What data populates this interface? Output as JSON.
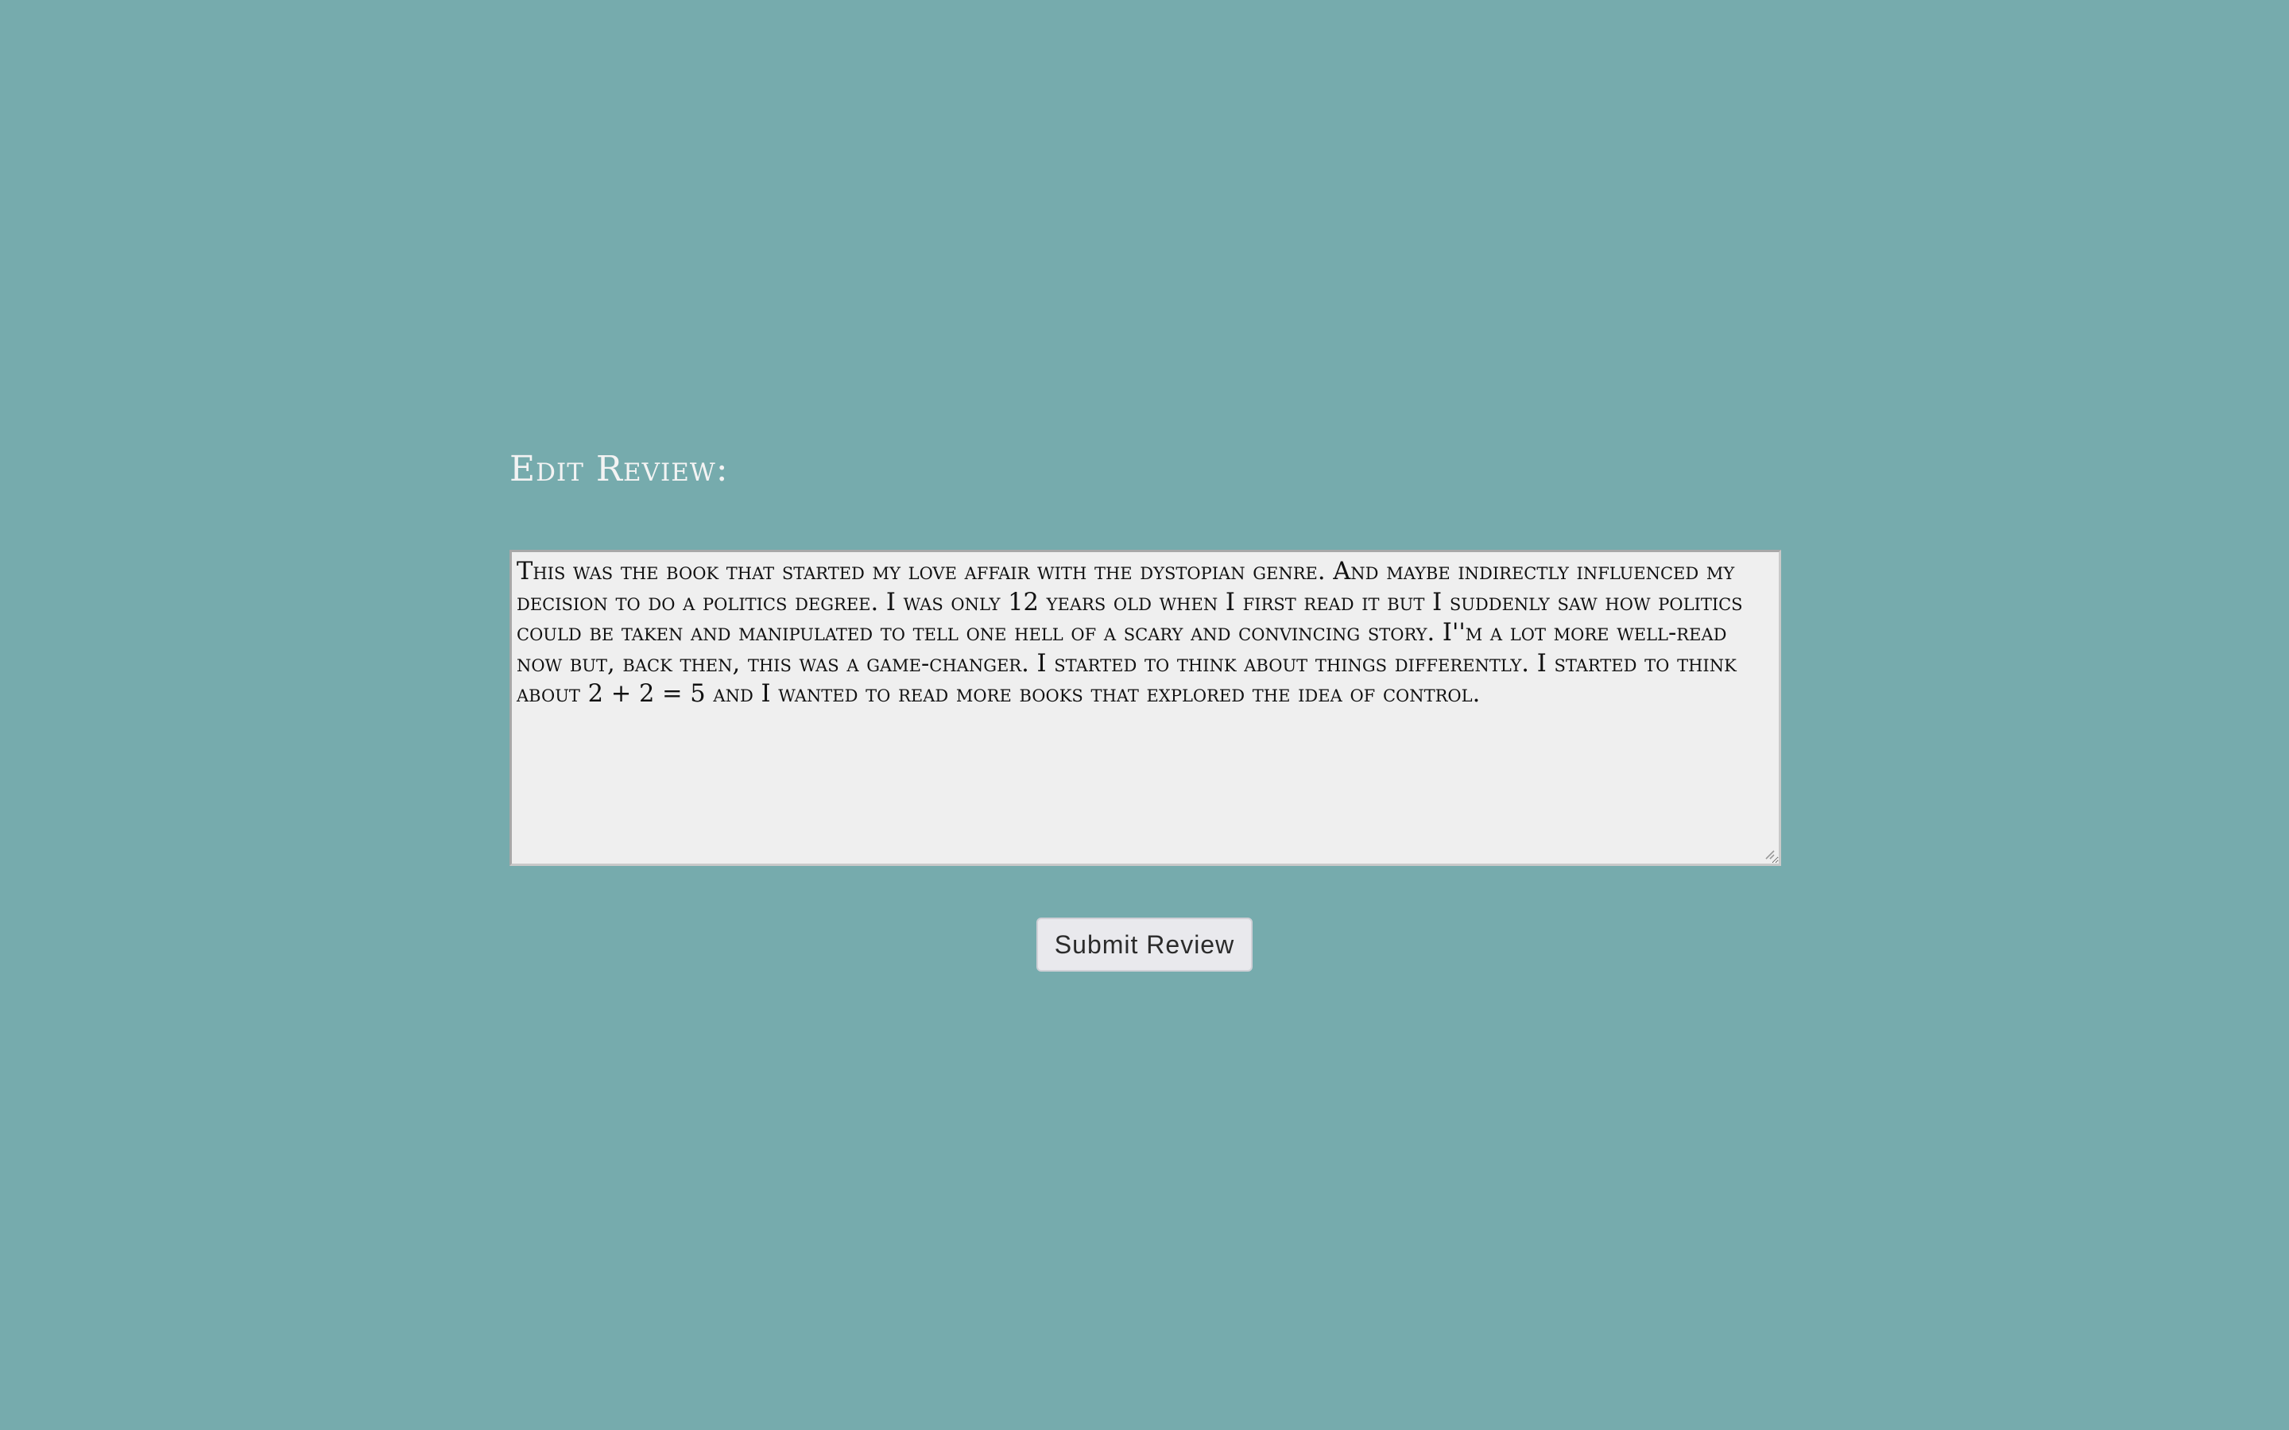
{
  "form": {
    "heading": "Edit Review:",
    "review_text": "This was the book that started my love affair with the dystopian genre. And maybe indirectly influenced my decision to do a politics degree. I was only 12 years old when I first read it but I suddenly saw how politics could be taken and manipulated to tell one hell of a scary and convincing story. I''m a lot more well-read now but, back then, this was a game-changer. I started to think about things differently. I started to think about 2 + 2 = 5 and I wanted to read more books that explored the idea of control.",
    "submit_label": "Submit Review"
  },
  "colors": {
    "background": "#76abad",
    "textarea_bg": "#efefef",
    "button_bg": "#e9e9ed",
    "heading_text": "#f3f3f3"
  }
}
